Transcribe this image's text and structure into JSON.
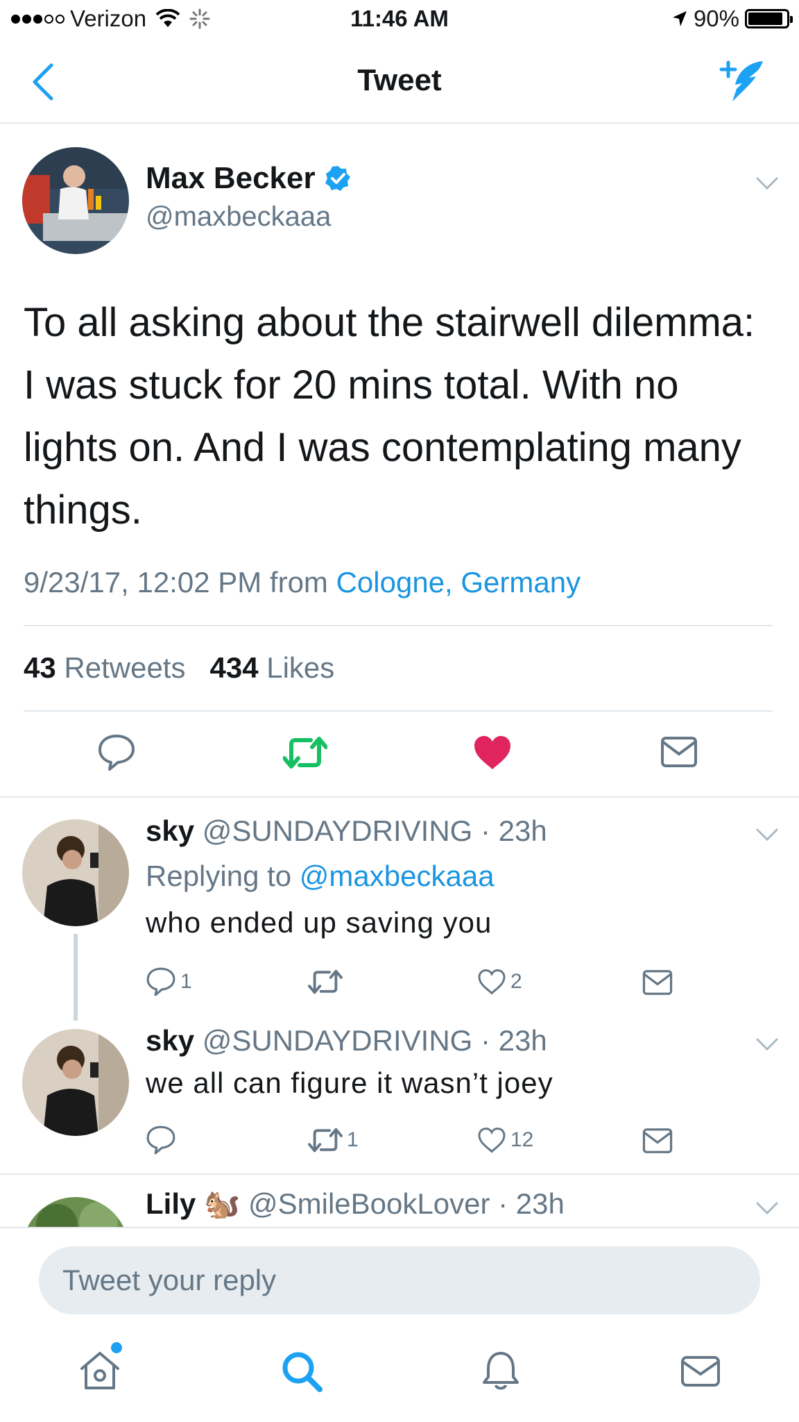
{
  "status_bar": {
    "carrier": "Verizon",
    "time": "11:46 AM",
    "battery": "90%",
    "battery_level": 0.9
  },
  "nav": {
    "title": "Tweet"
  },
  "tweet": {
    "name": "Max Becker",
    "handle": "@maxbeckaaa",
    "text": "To all asking about the stairwell dilemma: I was stuck for 20 mins total. With no lights on. And I was contemplating many things.",
    "date": "9/23/17, 12:02 PM",
    "from_label": "from",
    "location": "Cologne, Germany",
    "retweet_count": "43",
    "retweet_label": "Retweets",
    "like_count": "434",
    "like_label": "Likes",
    "liked": true,
    "colors": {
      "accent": "#1da1f2",
      "like": "#e0245e",
      "retweet": "#17bf63"
    }
  },
  "replies": [
    {
      "name": "sky",
      "handle": "@SUNDAYDRIVING",
      "time": "23h",
      "replying_label": "Replying to",
      "replying_to": "@maxbeckaaa",
      "text": "who ended up saving you",
      "reply_count": "1",
      "retweet_count": "",
      "like_count": "2"
    },
    {
      "name": "sky",
      "handle": "@SUNDAYDRIVING",
      "time": "23h",
      "text": "we all can figure it wasn’t joey",
      "reply_count": "",
      "retweet_count": "1",
      "like_count": "12"
    },
    {
      "name": "Lily",
      "emoji": "🐿️",
      "handle": "@SmileBookLover",
      "time": "23h"
    }
  ],
  "reply_box": {
    "placeholder": "Tweet your reply"
  },
  "tab_bar": [
    "home-icon",
    "search-icon",
    "notifications-icon",
    "messages-icon"
  ]
}
